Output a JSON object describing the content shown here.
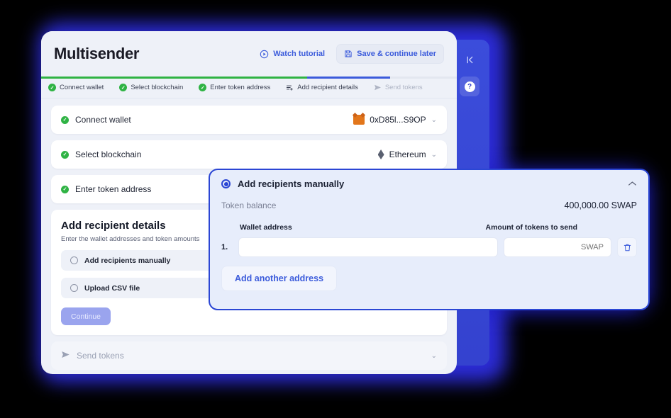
{
  "app": {
    "title": "Multisender",
    "header": {
      "watch_tutorial": "Watch tutorial",
      "watch_icon": "play-circle-icon",
      "save_later": "Save & continue later",
      "save_icon": "floppy-disk-icon"
    },
    "progress": {
      "green_pct": 64,
      "blue_pct": 84,
      "green_color": "#2fb344",
      "blue_color": "#3b5bdb",
      "track_color": "#e3e7f0"
    },
    "steps": [
      {
        "label": "Connect wallet",
        "state": "done",
        "icon": "check-circle-icon"
      },
      {
        "label": "Select blockchain",
        "state": "done",
        "icon": "check-circle-icon"
      },
      {
        "label": "Enter token address",
        "state": "done",
        "icon": "check-circle-icon"
      },
      {
        "label": "Add recipient details",
        "state": "active",
        "icon": "list-add-icon"
      },
      {
        "label": "Send tokens",
        "state": "upcoming",
        "icon": "send-icon"
      }
    ],
    "rows": [
      {
        "label": "Connect wallet",
        "value": "0xD85l...S9OP",
        "value_icon": "metamask-fox-icon",
        "chevron": "chevron-down-icon"
      },
      {
        "label": "Select blockchain",
        "value": "Ethereum",
        "value_icon": "ethereum-diamond-icon",
        "chevron": "chevron-down-icon"
      },
      {
        "label": "Enter token address",
        "value": "",
        "value_icon": "",
        "chevron": "chevron-down-icon"
      }
    ],
    "recipient_panel": {
      "title": "Add recipient details",
      "subtitle": "Enter the wallet addresses and token amounts",
      "options": [
        {
          "label": "Add recipients manually",
          "selected": false
        },
        {
          "label": "Upload CSV file",
          "selected": false
        }
      ],
      "continue_label": "Continue",
      "continue_disabled": true,
      "continue_color": "#9aa4ee"
    },
    "send_row": {
      "label": "Send tokens",
      "icon": "send-icon",
      "chevron": "chevron-down-icon"
    }
  },
  "sidebar": {
    "collapse_icon": "collapse-left-icon",
    "help_icon": "question-mark-icon",
    "help_label": "?",
    "color": "#3442cf"
  },
  "modal": {
    "title": "Add recipients manually",
    "radio_selected": true,
    "collapse_icon": "chevron-up-icon",
    "balance_label": "Token balance",
    "balance_value": "400,000.00 SWAP",
    "columns": {
      "wallet": "Wallet address",
      "amount": "Amount of tokens to send"
    },
    "entries": [
      {
        "index": "1.",
        "wallet_value": "",
        "wallet_placeholder": "",
        "amount_value": "",
        "amount_placeholder": "SWAP",
        "delete_icon": "trash-icon"
      }
    ],
    "add_another_label": "Add another address",
    "border_color": "#2b46d4",
    "background": "#e7edfb"
  },
  "theme": {
    "page_background": "#000000",
    "glow_color": "#2b2bd6",
    "card_background": "#eef1f8",
    "accent_blue": "#3b5bdb",
    "success_green": "#2fb344"
  }
}
